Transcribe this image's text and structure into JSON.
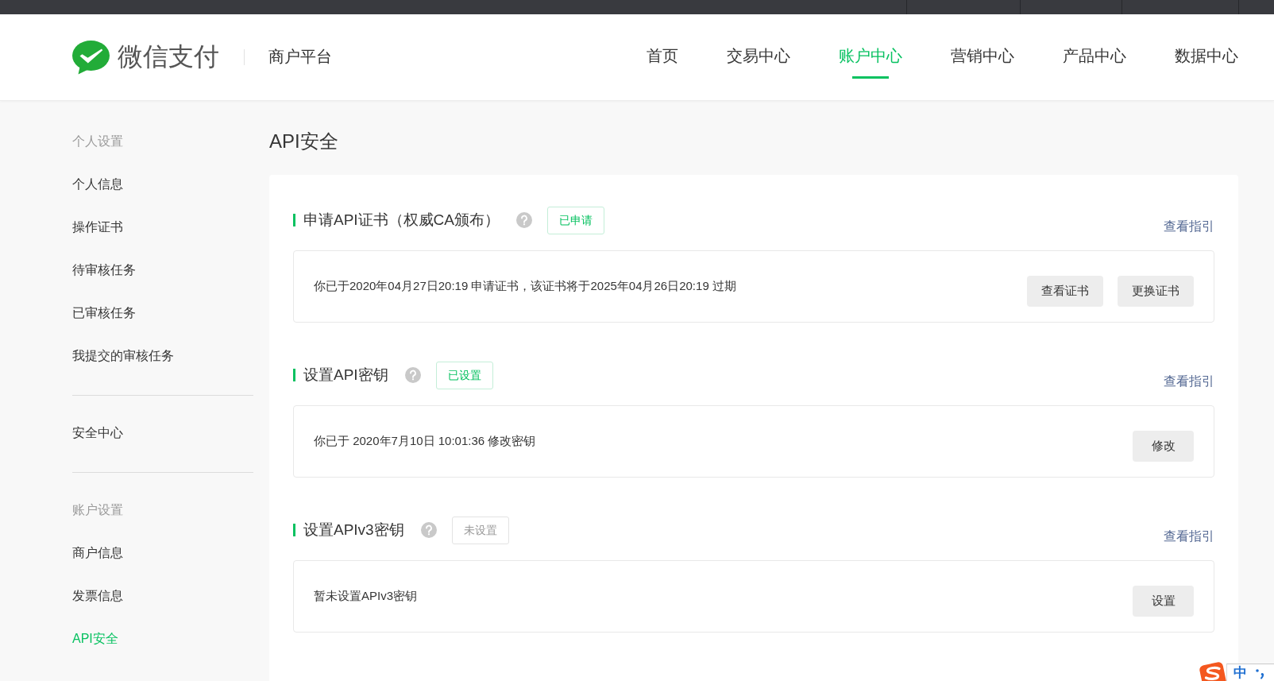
{
  "header": {
    "logo_text": "微信支付",
    "platform": "商户平台",
    "nav": [
      {
        "label": "首页",
        "selected": false
      },
      {
        "label": "交易中心",
        "selected": false
      },
      {
        "label": "账户中心",
        "selected": true
      },
      {
        "label": "营销中心",
        "selected": false
      },
      {
        "label": "产品中心",
        "selected": false
      },
      {
        "label": "数据中心",
        "selected": false
      }
    ]
  },
  "sidebar": {
    "groups": [
      {
        "heading": "个人设置",
        "items": [
          {
            "label": "个人信息",
            "selected": false
          },
          {
            "label": "操作证书",
            "selected": false
          },
          {
            "label": "待审核任务",
            "selected": false
          },
          {
            "label": "已审核任务",
            "selected": false
          },
          {
            "label": "我提交的审核任务",
            "selected": false
          }
        ]
      },
      {
        "items": [
          {
            "label": "安全中心",
            "selected": false
          }
        ]
      },
      {
        "heading": "账户设置",
        "items": [
          {
            "label": "商户信息",
            "selected": false
          },
          {
            "label": "发票信息",
            "selected": false
          },
          {
            "label": "API安全",
            "selected": true
          }
        ]
      }
    ]
  },
  "page_title": "API安全",
  "sections": [
    {
      "title": "申请API证书（权威CA颁布）",
      "status": {
        "label": "已申请",
        "done": true
      },
      "guide_link": "查看指引",
      "message": "你已于2020年04月27日20:19 申请证书，该证书将于2025年04月26日20:19 过期",
      "buttons": [
        "查看证书",
        "更换证书"
      ]
    },
    {
      "title": "设置API密钥",
      "status": {
        "label": "已设置",
        "done": true
      },
      "guide_link": "查看指引",
      "message": "你已于 2020年7月10日 10:01:36 修改密钥",
      "buttons": [
        "修改"
      ]
    },
    {
      "title": "设置APIv3密钥",
      "status": {
        "label": "未设置",
        "done": false
      },
      "guide_link": "查看指引",
      "message": "暂未设置APIv3密钥",
      "buttons": [
        "设置"
      ]
    }
  ],
  "input_method": {
    "mode": "中"
  }
}
